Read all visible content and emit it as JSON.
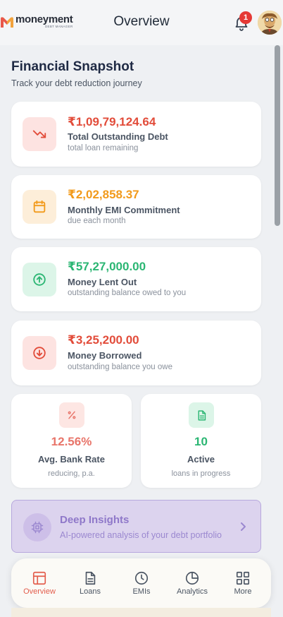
{
  "header": {
    "logo_text": "moneyment",
    "logo_subtext": "DEBT MANAGER",
    "title": "Overview",
    "notification_count": "1"
  },
  "snapshot": {
    "title": "Financial Snapshot",
    "subtitle": "Track your debt reduction journey"
  },
  "cards": [
    {
      "amount": "₹1,09,79,124.64",
      "label": "Total Outstanding Debt",
      "desc": "total loan remaining",
      "icon": "trending-down-icon",
      "color": "#e24c3a",
      "bg": "#fde3e1"
    },
    {
      "amount": "₹2,02,858.37",
      "label": "Monthly EMI Commitment",
      "desc": "due each month",
      "icon": "calendar-icon",
      "color": "#f29a1b",
      "bg": "#fdeed9"
    },
    {
      "amount": "₹57,27,000.00",
      "label": "Money Lent Out",
      "desc": "outstanding balance owed to you",
      "icon": "arrow-up-circle-icon",
      "color": "#2bb673",
      "bg": "#dcf5e8"
    },
    {
      "amount": "₹3,25,200.00",
      "label": "Money Borrowed",
      "desc": "outstanding balance you owe",
      "icon": "arrow-down-circle-icon",
      "color": "#e24c3a",
      "bg": "#fde3e1"
    }
  ],
  "stats": [
    {
      "value": "12.56%",
      "label": "Avg. Bank Rate",
      "desc": "reducing, p.a.",
      "icon": "percent-icon",
      "color": "#e8756a",
      "bg": "#fde6e3"
    },
    {
      "value": "10",
      "label": "Active",
      "desc": "loans in progress",
      "icon": "document-icon",
      "color": "#2bb673",
      "bg": "#dcf5e8"
    }
  ],
  "insights": {
    "title": "Deep Insights",
    "subtitle": "AI-powered analysis of your debt portfolio"
  },
  "tabs": [
    {
      "label": "Overview",
      "icon": "overview-icon",
      "active": true
    },
    {
      "label": "Loans",
      "icon": "loans-icon",
      "active": false
    },
    {
      "label": "EMIs",
      "icon": "clock-icon",
      "active": false
    },
    {
      "label": "Analytics",
      "icon": "pie-chart-icon",
      "active": false
    },
    {
      "label": "More",
      "icon": "grid-icon",
      "active": false
    }
  ],
  "colors": {
    "accent": "#e35d4c",
    "insights_bg": "#dcd3ee",
    "insights_text": "#8f78c9"
  }
}
